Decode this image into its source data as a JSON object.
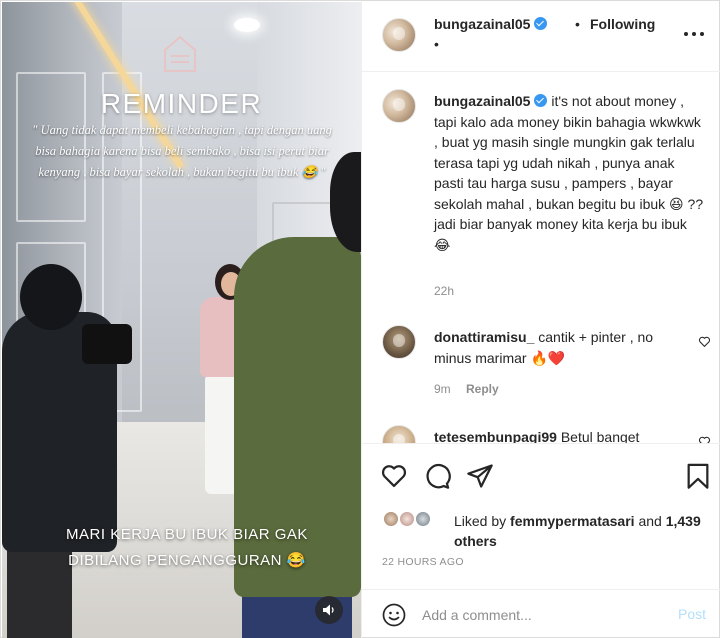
{
  "media": {
    "overlay_title": "REMINDER",
    "overlay_quote": "\" Uang tidak dapat membeli kebahagian , tapi dengan uang bisa bahagia karena bisa beli sembako , bisa isi perut biar kenyang , bisa bayar sekolah , bukan begitu bu ibuk 😂 \"",
    "bottom_caption": "MARI KERJA BU IBUK BIAR GAK DIBILANG PENGANGGURAN 😂",
    "mute_icon": "speaker-icon"
  },
  "header": {
    "username": "bungazainal05",
    "separator": "•",
    "follow_state": "Following",
    "second_line": "•"
  },
  "caption": {
    "username": "bungazainal05",
    "text": "it's not about money , tapi kalo ada money bikin bahagia wkwkwk , buat yg masih single mungkin gak terlalu terasa tapi yg udah nikah , punya anak pasti tau harga susu , pampers , bayar sekolah mahal , bukan begitu bu ibuk 😆 ?? jadi biar banyak money kita kerja bu ibuk 😂",
    "time": "22h"
  },
  "comments": [
    {
      "username": "donattiramisu_",
      "text": "cantik + pinter , no minus marimar 🔥❤️",
      "time": "9m",
      "reply_label": "Reply"
    },
    {
      "username": "tetesembunpagi99",
      "text": "Betul banget"
    }
  ],
  "actions": {
    "like_icon": "heart-icon",
    "comment_icon": "comment-icon",
    "share_icon": "send-icon",
    "save_icon": "bookmark-icon"
  },
  "likes": {
    "prefix": "Liked by",
    "user": "femmypermatasari",
    "joiner": "and",
    "others": "1,439 others"
  },
  "timestamp": "22 HOURS AGO",
  "add_comment": {
    "placeholder": "Add a comment...",
    "post_label": "Post"
  },
  "colors": {
    "verified": "#3897f0",
    "post_disabled": "#b2dffc",
    "secondary_text": "#8e8e8e",
    "border": "#efefef"
  }
}
